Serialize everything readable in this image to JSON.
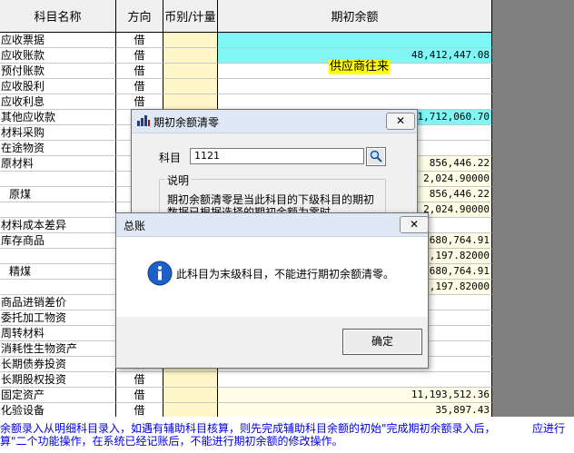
{
  "headers": {
    "name": "科目名称",
    "direction": "方向",
    "currency": "币别/计量",
    "balance": "期初余额"
  },
  "rows": [
    {
      "name": "应收票据",
      "dir": "借",
      "amount": ""
    },
    {
      "name": "应收账款",
      "dir": "借",
      "amount": "48,412,447.08"
    },
    {
      "name": "预付账款",
      "dir": "借",
      "amount": ""
    },
    {
      "name": "应收股利",
      "dir": "借",
      "amount": ""
    },
    {
      "name": "应收利息",
      "dir": "借",
      "amount": ""
    },
    {
      "name": "其他应收款",
      "dir": "借",
      "amount": "21,712,060.70"
    },
    {
      "name": "材料采购",
      "dir": "",
      "amount": ""
    },
    {
      "name": "在途物资",
      "dir": "",
      "amount": ""
    },
    {
      "name": "原材料",
      "dir": "",
      "amount": "856,446.22"
    },
    {
      "name": "",
      "dir": "",
      "amount": "2,024.90000"
    },
    {
      "name": "原煤",
      "dir": "",
      "amount": "856,446.22"
    },
    {
      "name": "",
      "dir": "",
      "amount": "2,024.90000"
    },
    {
      "name": "材料成本差异",
      "dir": "",
      "amount": ""
    },
    {
      "name": "库存商品",
      "dir": "",
      "amount": "1,680,764.91"
    },
    {
      "name": "",
      "dir": "",
      "amount": "9,197.82000"
    },
    {
      "name": "精煤",
      "dir": "",
      "amount": "1,680,764.91"
    },
    {
      "name": "",
      "dir": "",
      "amount": "9,197.82000"
    },
    {
      "name": "商品进销差价",
      "dir": "",
      "amount": ""
    },
    {
      "name": "委托加工物资",
      "dir": "",
      "amount": ""
    },
    {
      "name": "周转材料",
      "dir": "",
      "amount": ""
    },
    {
      "name": "消耗性生物资产",
      "dir": "",
      "amount": ""
    },
    {
      "name": "长期债券投资",
      "dir": "借",
      "amount": ""
    },
    {
      "name": "长期股权投资",
      "dir": "借",
      "amount": ""
    },
    {
      "name": "固定资产",
      "dir": "借",
      "amount": "11,193,512.36"
    },
    {
      "name": "化验设备",
      "dir": "借",
      "amount": "35,897.43"
    }
  ],
  "tooltip": "供应商往来",
  "clear_dialog": {
    "title": "期初余额清零",
    "subject_label": "科目",
    "subject_value": "1121",
    "group_label": "说明",
    "desc_line1": "期初余额清零是当此科目的下级科目的期初",
    "desc_line2": "数据已根据选择的期初余额为零时，"
  },
  "msg_dialog": {
    "title": "总账",
    "message": "此科目为末级科目，不能进行期初余额清零。",
    "ok": "确定"
  },
  "bottom_text": {
    "line1a": "余额录入从明细科目录入，如遇有辅助科目核算，则先完成辅助科目余额的初始",
    "line1b": "\"完成期初余额录入后，",
    "line1c": "应进行",
    "line2": "算\"二个功能操作，在系统已经记账后，不能进行期初余额的修改操作。"
  },
  "colors": {
    "highlight_cyan": "#7ff7f7",
    "currency_col": "#fff7c8",
    "tooltip_bg": "#ffff00",
    "hint_blue": "#0000e0"
  }
}
